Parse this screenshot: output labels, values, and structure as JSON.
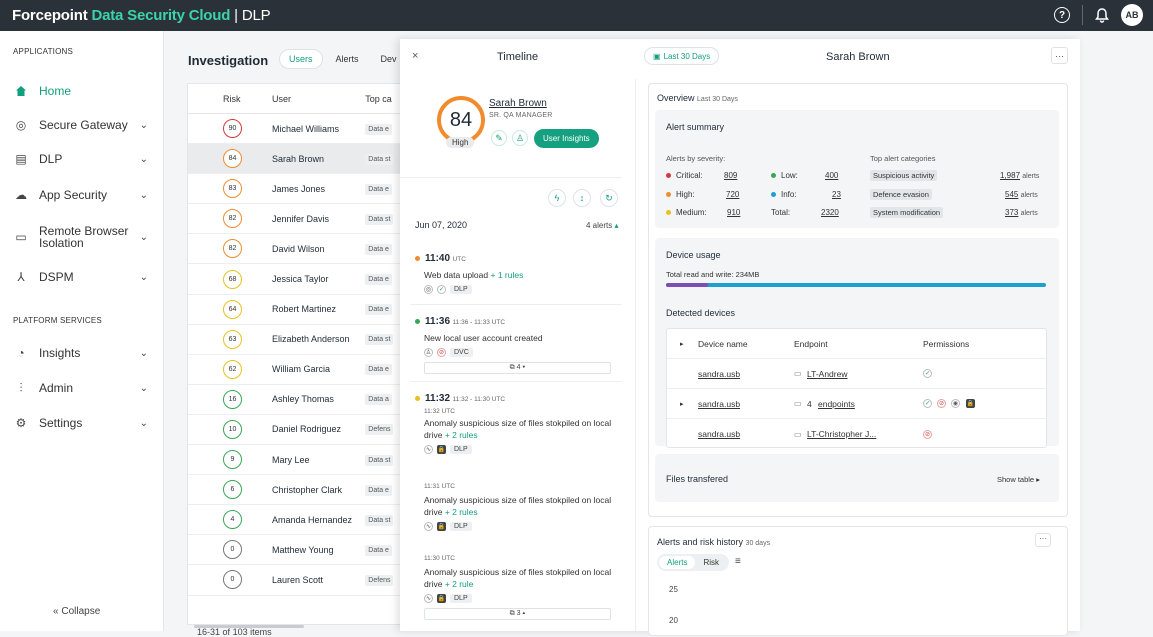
{
  "topbar": {
    "brand_part1": "Forcepoint",
    "brand_part2": "Data Security Cloud",
    "brand_part3": "| DLP",
    "help_icon": "?",
    "avatar_initials": "AB",
    "accent": "#3ad3a8"
  },
  "sidebar": {
    "section_applications": "APPLICATIONS",
    "section_platform": "PLATFORM SERVICES",
    "items": [
      {
        "label": "Home",
        "icon": "home-icon"
      },
      {
        "label": "Secure Gateway",
        "icon": "globe-icon"
      },
      {
        "label": "DLP",
        "icon": "document-icon"
      },
      {
        "label": "App Security",
        "icon": "cloud-icon"
      },
      {
        "label": "Remote Browser",
        "label2": "Isolation",
        "icon": "monitor-icon"
      },
      {
        "label": "DSPM",
        "icon": "network-icon"
      },
      {
        "label": "Insights",
        "icon": "pie-chart-icon"
      },
      {
        "label": "Admin",
        "icon": "sliders-icon"
      },
      {
        "label": "Settings",
        "icon": "gear-icon"
      }
    ],
    "collapse_label": "Collapse"
  },
  "investigation": {
    "title": "Investigation",
    "tabs": [
      "Users",
      "Alerts",
      "Dev"
    ],
    "columns": [
      "Risk",
      "User",
      "Top ca"
    ],
    "rows": [
      {
        "risk": "90",
        "user": "Michael Williams",
        "cat": "Data e"
      },
      {
        "risk": "84",
        "user": "Sarah Brown",
        "cat": "Data st"
      },
      {
        "risk": "83",
        "user": "James Jones",
        "cat": "Data e"
      },
      {
        "risk": "82",
        "user": "Jennifer Davis",
        "cat": "Data st"
      },
      {
        "risk": "82",
        "user": "David Wilson",
        "cat": "Data e"
      },
      {
        "risk": "68",
        "user": "Jessica Taylor",
        "cat": "Data e"
      },
      {
        "risk": "64",
        "user": "Robert Martinez",
        "cat": "Data e"
      },
      {
        "risk": "63",
        "user": "Elizabeth Anderson",
        "cat": "Data st"
      },
      {
        "risk": "62",
        "user": "William Garcia",
        "cat": "Data e"
      },
      {
        "risk": "16",
        "user": "Ashley Thomas",
        "cat": "Data a"
      },
      {
        "risk": "10",
        "user": "Daniel Rodriguez",
        "cat": "Defens"
      },
      {
        "risk": "9",
        "user": "Mary Lee",
        "cat": "Data st"
      },
      {
        "risk": "6",
        "user": "Christopher Clark",
        "cat": "Data e"
      },
      {
        "risk": "4",
        "user": "Amanda Hernandez",
        "cat": "Data st"
      },
      {
        "risk": "0",
        "user": "Matthew Young",
        "cat": "Data e"
      },
      {
        "risk": "0",
        "user": "Lauren Scott",
        "cat": "Defens"
      }
    ],
    "risk_colors": [
      "#d23b3b",
      "#f08c2e",
      "#f08c2e",
      "#f08c2e",
      "#f08c2e",
      "#e8c21c",
      "#e8c21c",
      "#e8c21c",
      "#e8c21c",
      "#3aa655",
      "#3aa655",
      "#3aa655",
      "#3aa655",
      "#3aa655",
      "#777777",
      "#777777"
    ],
    "footer_range": "16-31",
    "footer_of": "of",
    "footer_total": "103 items"
  },
  "panel": {
    "close": "×",
    "timeline_title": "Timeline",
    "date_filter": "Last 30 Days",
    "user_name": "Sarah Brown",
    "more": "···",
    "score": "84",
    "score_label": "High",
    "role": "SR. QA MANAGER",
    "user_insights": "User Insights",
    "date": "Jun 07, 2020",
    "alerts_count": "4 alerts",
    "events": [
      {
        "time": "11:40",
        "utc": "UTC",
        "desc": "Web data upload",
        "rules": "+ 1 rules",
        "tag": "DLP",
        "color": "#f08c2e"
      },
      {
        "time": "11:36",
        "utc": "11:36 - 11:33 UTC",
        "desc": "New local user account created",
        "tag": "DVC",
        "expander": "4",
        "color": "#3aa655"
      },
      {
        "time": "11:32",
        "utc": "11:32 - 11:30 UTC",
        "sub": "11:32 UTC",
        "desc": "Anomaly suspicious size of files stokpiled on local drive",
        "rules": "+ 2 rules",
        "tag": "DLP",
        "color": "#e8c21c"
      },
      {
        "sub": "11:31 UTC",
        "desc": "Anomaly suspicious size of files stokpiled on local drive",
        "rules": "+ 2 rules",
        "tag": "DLP"
      },
      {
        "sub": "11:30 UTC",
        "desc": "Anomaly suspicious size of files stokpiled on local drive",
        "rules": "+ 2 rule",
        "tag": "DLP",
        "expander": "3"
      }
    ],
    "overview": {
      "title": "Overview",
      "period": "Last 30 Days",
      "alert_summary": "Alert summary",
      "by_severity": "Alerts by severity:",
      "top_categories": "Top alert categories",
      "critical_label": "Critical:",
      "critical": "809",
      "high_label": "High:",
      "high": "720",
      "medium_label": "Medium:",
      "medium": "910",
      "low_label": "Low:",
      "low": "400",
      "info_label": "Info:",
      "info": "23",
      "total_label": "Total:",
      "total": "2320",
      "categories": [
        {
          "name": "Suspicious activity",
          "count": "1,987",
          "unit": "alerts"
        },
        {
          "name": "Defence evasion",
          "count": "545",
          "unit": "alerts"
        },
        {
          "name": "System modification",
          "count": "373",
          "unit": "alerts"
        }
      ],
      "device_usage": "Device usage",
      "total_rw": "Total read and write: 234MB",
      "usage_fraction": 0.11,
      "detected_devices": "Detected devices",
      "dev_cols": [
        "Device name",
        "Endpoint",
        "Permissions"
      ],
      "devices": [
        {
          "name": "sandra.usb",
          "endpoint": "LT-Andrew",
          "count": ""
        },
        {
          "name": "sandra.usb",
          "endpoint": "endpoints",
          "count": "4"
        },
        {
          "name": "sandra.usb",
          "endpoint": "LT-Christopher J...",
          "count": ""
        }
      ],
      "files_transferred": "Files transfered",
      "show_table": "Show table ▸"
    },
    "history": {
      "title": "Alerts and risk history",
      "period": "30 days",
      "tabs": [
        "Alerts",
        "Risk"
      ],
      "y_ticks": [
        "25",
        "20"
      ]
    }
  }
}
